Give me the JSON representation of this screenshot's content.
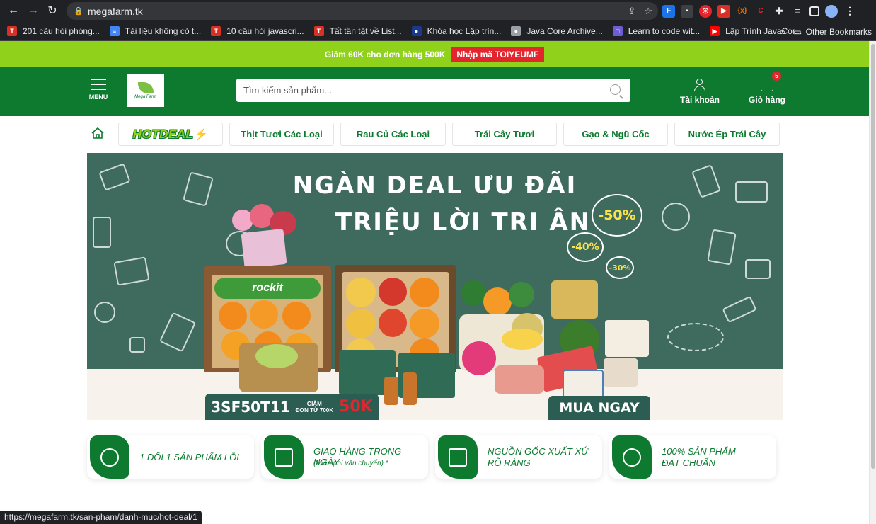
{
  "browser": {
    "url": "megafarm.tk",
    "bookmarks": [
      {
        "label": "201 câu hỏi phỏng...",
        "color": "#d93025",
        "glyph": "T"
      },
      {
        "label": "Tài liệu không có t...",
        "color": "#4285f4",
        "glyph": "≡"
      },
      {
        "label": "10 câu hỏi javascri...",
        "color": "#d93025",
        "glyph": "T"
      },
      {
        "label": "Tất tần tật về List...",
        "color": "#d93025",
        "glyph": "T"
      },
      {
        "label": "Khóa học Lập trìn...",
        "color": "#1a3a8f",
        "glyph": "●"
      },
      {
        "label": "Java Core Archive...",
        "color": "#9aa0a6",
        "glyph": "●"
      },
      {
        "label": "Learn to code wit...",
        "color": "#6d5fd3",
        "glyph": "□"
      },
      {
        "label": "Lập Trình JavaCor...",
        "color": "#ff0000",
        "glyph": "▶"
      }
    ],
    "bookmarks_more": "»",
    "other_bookmarks": "Other Bookmarks",
    "status_url": "https://megafarm.tk/san-pham/danh-muc/hot-deal/1"
  },
  "promo": {
    "text": "Giảm 60K cho đơn hàng 500K",
    "code_label": "Nhập mã TOIYEUMF"
  },
  "header": {
    "menu_label": "MENU",
    "logo_text": "Mega Farm",
    "search_placeholder": "Tìm kiếm sản phẩm...",
    "account_label": "Tài khoản",
    "cart_label": "Giỏ hàng",
    "cart_count": "5"
  },
  "categories": {
    "hotdeal": "HOTDEAL",
    "items": [
      "Thịt Tươi Các Loại",
      "Rau Củ Các Loại",
      "Trái Cây Tươi",
      "Gạo & Ngũ Cốc",
      "Nước Ép Trái Cây"
    ]
  },
  "banner": {
    "line1": "NGÀN DEAL ƯU ĐÃI",
    "line2": "TRIỆU LỜI TRI ÂN",
    "discount_big": "-50%",
    "discount_mid": "-40%",
    "discount_small": "-30%",
    "box_label": "rockit",
    "promo_code": "3SF50T11",
    "promo_giam": "GIẢM",
    "promo_condition": "ĐƠN TỪ 700K",
    "promo_value": "50K",
    "buy_now": "MUA NGAY"
  },
  "features": [
    {
      "line1": "1 ĐỔI 1 SẢN PHẨM LỖI",
      "line2": ""
    },
    {
      "line1": "GIAO HÀNG TRONG NGÀY",
      "line2": "(Miễn phí vận chuyển) *"
    },
    {
      "line1": "NGUỒN GỐC XUẤT XỨ",
      "line2": "RÕ RÀNG"
    },
    {
      "line1": "100% SẢN PHẨM",
      "line2": "ĐẠT CHUẨN"
    }
  ]
}
